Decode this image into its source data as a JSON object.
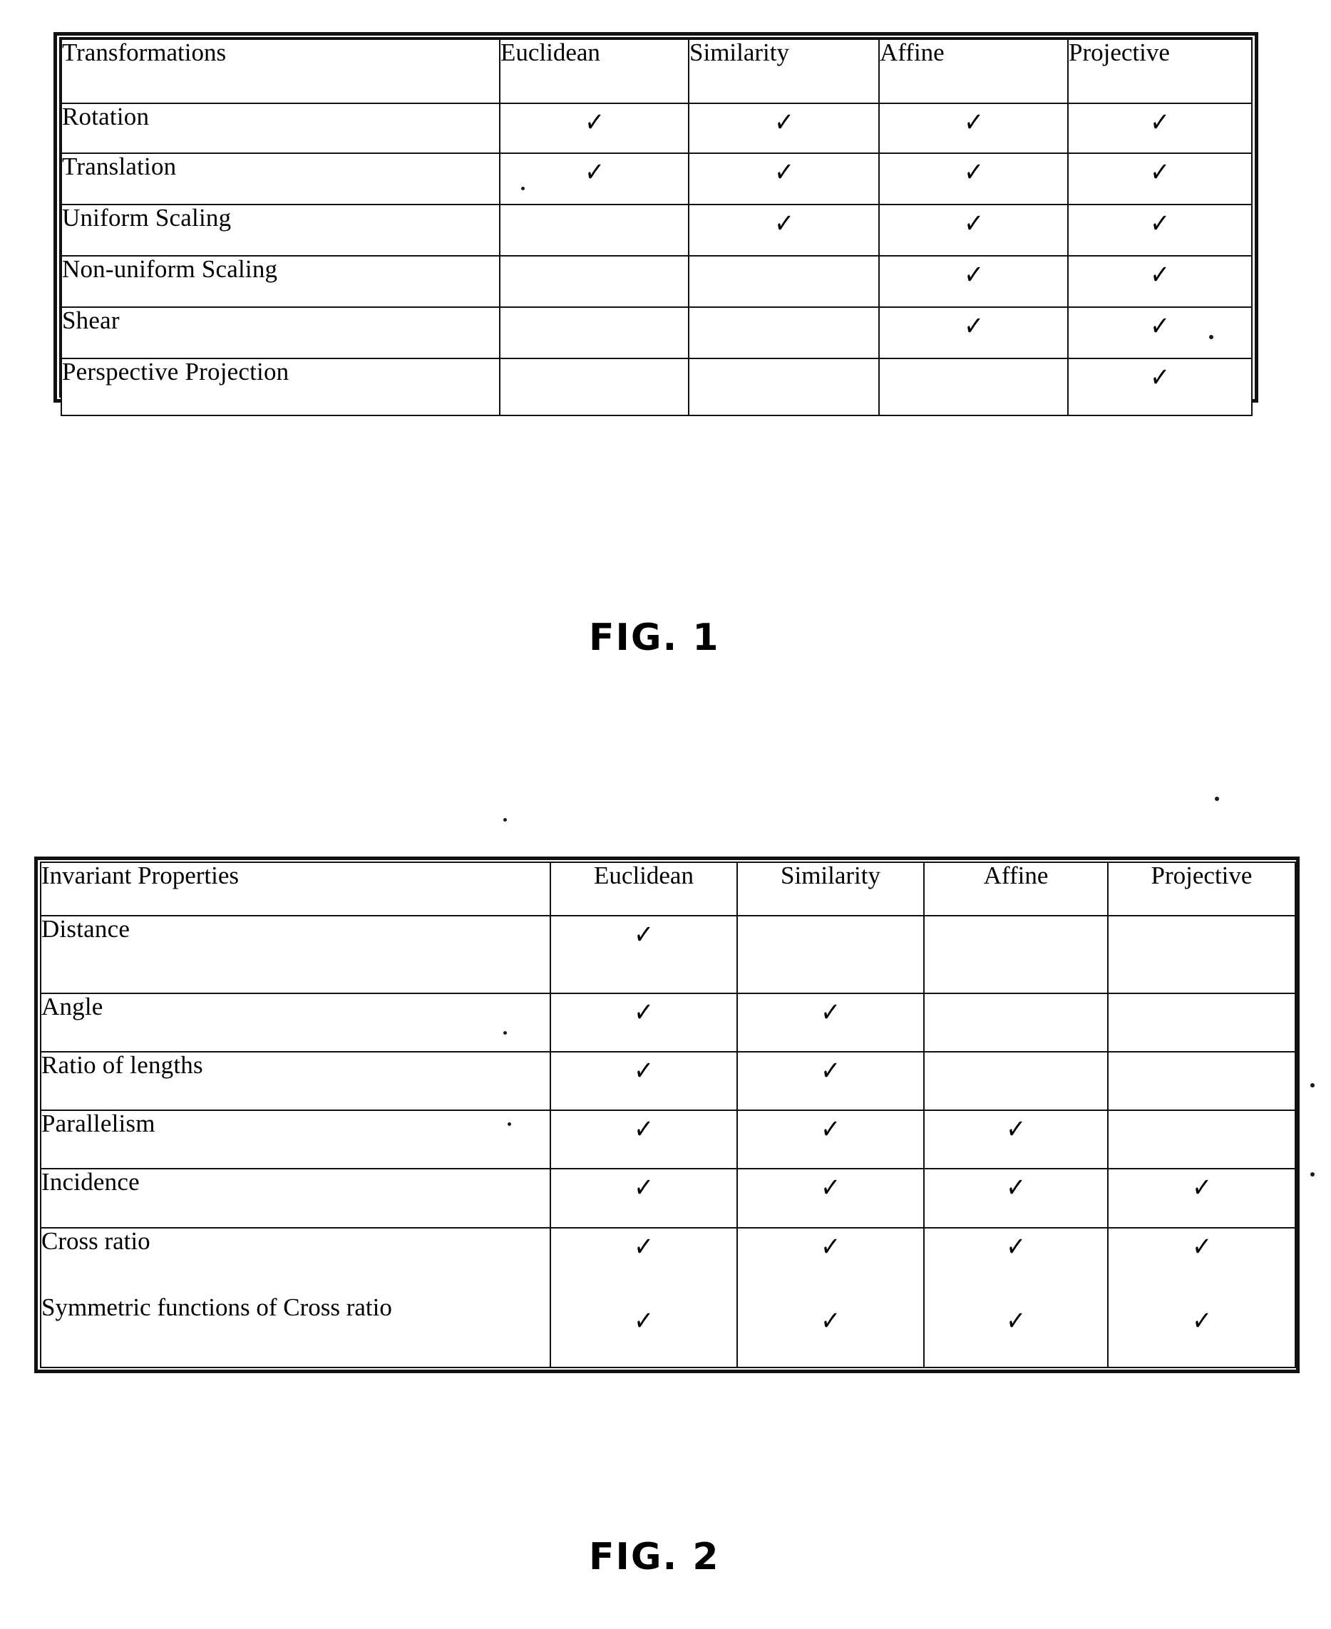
{
  "document": {
    "type": "patent-figure-sheet",
    "figures": [
      {
        "caption": "FIG. 1",
        "table": {
          "columns": [
            "Transformations",
            "Euclidean",
            "Similarity",
            "Affine",
            "Projective"
          ],
          "rows": [
            {
              "label": "Rotation",
              "marks": [
                true,
                true,
                true,
                true
              ]
            },
            {
              "label": "Translation",
              "marks": [
                true,
                true,
                true,
                true
              ]
            },
            {
              "label": "Uniform Scaling",
              "marks": [
                false,
                true,
                true,
                true
              ]
            },
            {
              "label": "Non-uniform Scaling",
              "marks": [
                false,
                false,
                true,
                true
              ]
            },
            {
              "label": "Shear",
              "marks": [
                false,
                false,
                true,
                true
              ]
            },
            {
              "label": "Perspective Projection",
              "marks": [
                false,
                false,
                false,
                true
              ]
            }
          ]
        }
      },
      {
        "caption": "FIG. 2",
        "table": {
          "columns": [
            "Invariant Properties",
            "Euclidean",
            "Similarity",
            "Affine",
            "Projective"
          ],
          "rows": [
            {
              "label": "Distance",
              "marks": [
                true,
                false,
                false,
                false
              ]
            },
            {
              "label": "Angle",
              "marks": [
                true,
                true,
                false,
                false
              ]
            },
            {
              "label": "Ratio of lengths",
              "marks": [
                true,
                true,
                false,
                false
              ]
            },
            {
              "label": "Parallelism",
              "marks": [
                true,
                true,
                true,
                false
              ]
            },
            {
              "label": "Incidence",
              "marks": [
                true,
                true,
                true,
                true
              ]
            },
            {
              "label": "Cross ratio",
              "label2": "Symmetric functions of Cross ratio",
              "marks": [
                true,
                true,
                true,
                true
              ],
              "marks2": [
                true,
                true,
                true,
                true
              ]
            }
          ]
        }
      }
    ],
    "check_glyph": "✓"
  }
}
